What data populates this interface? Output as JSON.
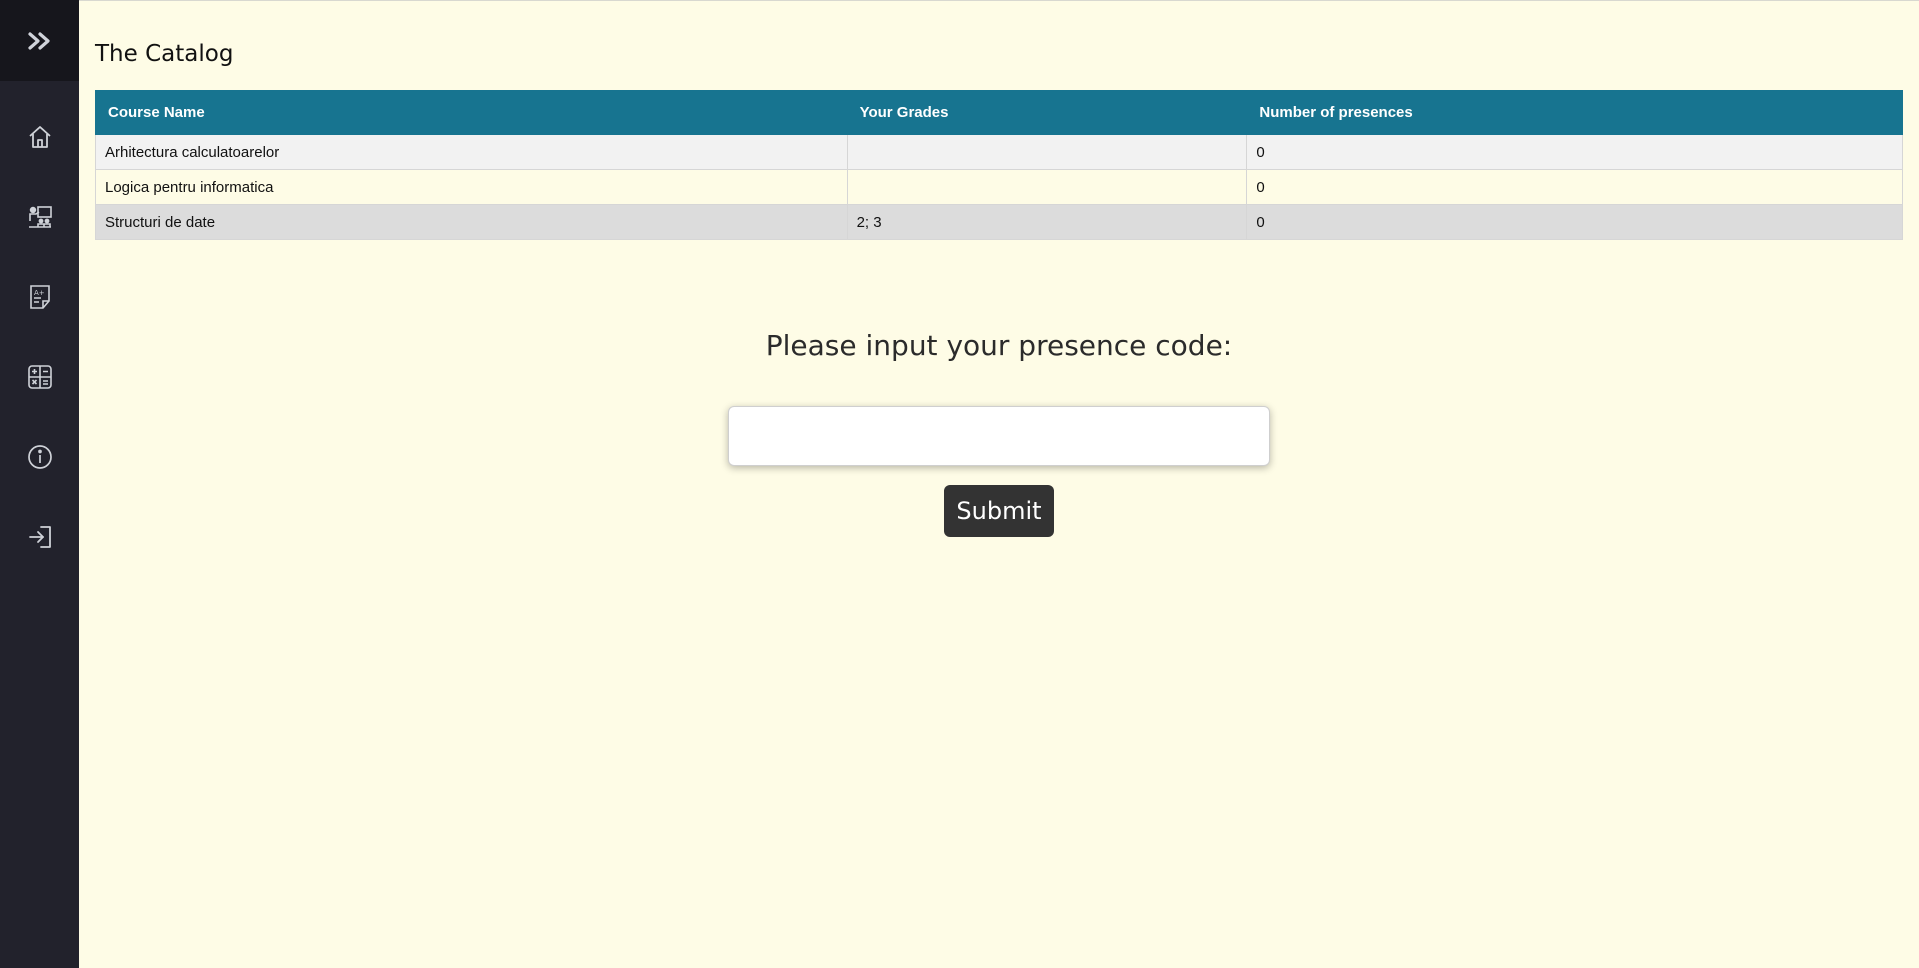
{
  "sidebar": {
    "toggle_icon": "double-chevron-right-icon",
    "icon_color": "#cfd2d8",
    "items": [
      {
        "icon": "home-icon"
      },
      {
        "icon": "teacher-classroom-icon"
      },
      {
        "icon": "grades-sheet-icon"
      },
      {
        "icon": "calculator-icon"
      },
      {
        "icon": "info-icon"
      },
      {
        "icon": "login-icon"
      }
    ]
  },
  "main": {
    "title": "The Catalog",
    "table": {
      "headers": [
        "Course Name",
        "Your Grades",
        "Number of presences"
      ],
      "rows": [
        {
          "course": "Arhitectura calculatoarelor",
          "grades": "",
          "presences": "0"
        },
        {
          "course": "Logica pentru informatica",
          "grades": "",
          "presences": "0"
        },
        {
          "course": "Structuri de date",
          "grades": "2; 3",
          "presences": "0"
        }
      ]
    },
    "presence": {
      "prompt": "Please input your presence code:",
      "input_value": "",
      "input_placeholder": "",
      "submit_label": "Submit"
    }
  },
  "colors": {
    "background": "#fefce6",
    "sidebar": "#22222c",
    "table_header": "#177490",
    "button": "#333333"
  }
}
